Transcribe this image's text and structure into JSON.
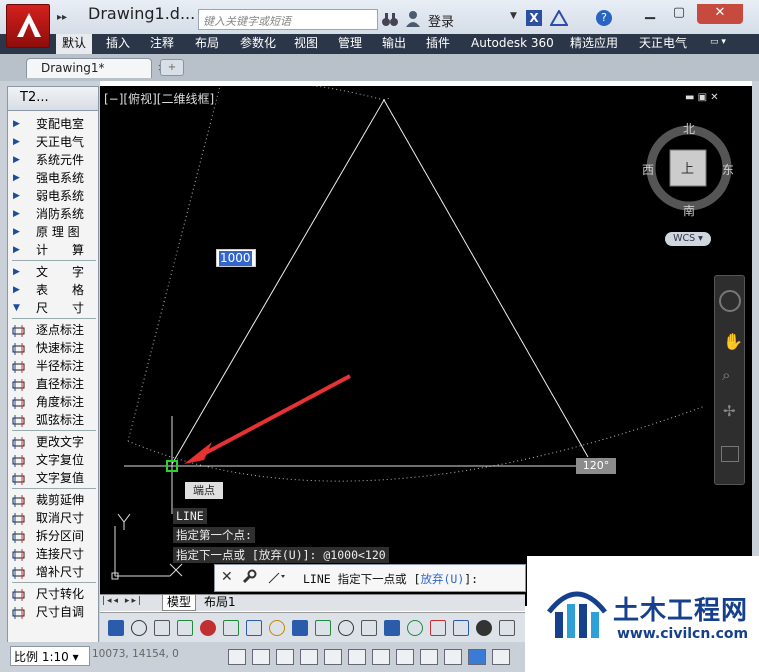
{
  "app": {
    "doc_title": "Drawing1.d...",
    "search_placeholder": "键入关键字或短语",
    "login": "登录",
    "help": "?"
  },
  "ribbon_tabs": [
    "默认",
    "插入",
    "注释",
    "布局",
    "参数化",
    "视图",
    "管理",
    "输出",
    "插件",
    "Autodesk 360",
    "精选应用",
    "天正电气"
  ],
  "doc_tab": {
    "name": "Drawing1*",
    "close": "×"
  },
  "panel": {
    "title": "T2...",
    "items": [
      "变配电室",
      "天正电气",
      "系统元件",
      "强电系统",
      "弱电系统",
      "消防系统",
      "原 理 图",
      "计　　算",
      "文　　字",
      "表　　格",
      "尺　　寸",
      "逐点标注",
      "快速标注",
      "半径标注",
      "直径标注",
      "角度标注",
      "弧弦标注",
      "更改文字",
      "文字复位",
      "文字复值",
      "裁剪延伸",
      "取消尺寸",
      "拆分区间",
      "连接尺寸",
      "增补尺寸",
      "尺寸转化",
      "尺寸自调"
    ]
  },
  "viewport": {
    "label": "[−][俯视][二维线框]",
    "compass": {
      "north": "北",
      "south": "南",
      "east": "东",
      "west": "西",
      "top": "上"
    },
    "wcs": "WCS",
    "dim_input": "1000",
    "angle": "120°",
    "snap_tooltip": "端点"
  },
  "command": {
    "history": [
      "LINE",
      "指定第一个点:",
      "指定下一点或 [放弃(U)]: @1000<120"
    ],
    "prompt": "LINE 指定下一点或 [",
    "option": "放弃(U)",
    "prompt_end": "]:"
  },
  "layout_tabs": [
    "模型",
    "布局1"
  ],
  "status": {
    "scale": "比例 1:10",
    "coords": "10073, 14154, 0"
  },
  "watermark": {
    "title": "土木工程网",
    "url": "www.civilcn.com"
  }
}
